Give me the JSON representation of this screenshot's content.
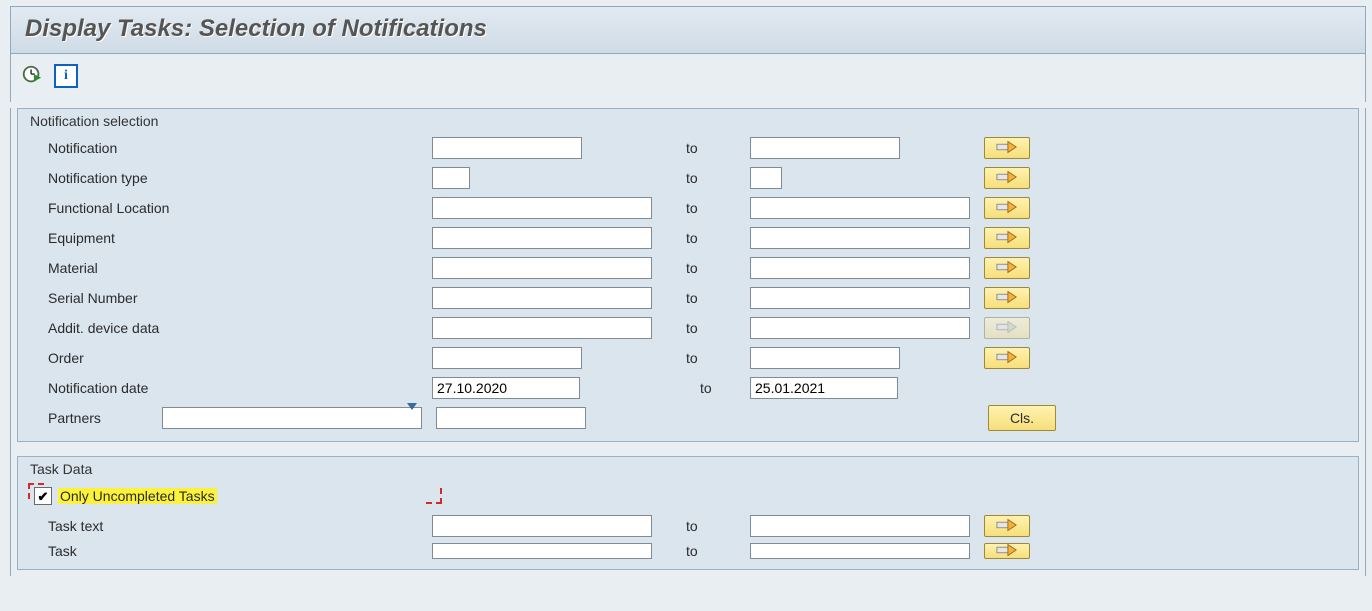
{
  "header": {
    "title": "Display Tasks: Selection of Notifications"
  },
  "toolbar": {
    "execute_icon": "execute-clock-icon",
    "info_icon": "i"
  },
  "groups": {
    "notif_sel": {
      "title": "Notification selection",
      "to_label": "to",
      "fields": {
        "notification": {
          "label": "Notification",
          "from": "",
          "to": ""
        },
        "notification_type": {
          "label": "Notification type",
          "from": "",
          "to": ""
        },
        "func_location": {
          "label": "Functional Location",
          "from": "",
          "to": ""
        },
        "equipment": {
          "label": "Equipment",
          "from": "",
          "to": ""
        },
        "material": {
          "label": "Material",
          "from": "",
          "to": ""
        },
        "serial_number": {
          "label": "Serial Number",
          "from": "",
          "to": ""
        },
        "addit_device": {
          "label": "Addit. device data",
          "from": "",
          "to": ""
        },
        "order": {
          "label": "Order",
          "from": "",
          "to": ""
        },
        "notif_date": {
          "label": "Notification date",
          "from": "27.10.2020",
          "to": "25.01.2021"
        },
        "partners": {
          "label": "Partners",
          "combo": "",
          "value": ""
        }
      },
      "cls_button": "Cls."
    },
    "task_data": {
      "title": "Task Data",
      "only_uncompleted": {
        "label": "Only Uncompleted Tasks",
        "checked": true
      },
      "to_label": "to",
      "fields": {
        "task_text": {
          "label": "Task text",
          "from": "",
          "to": ""
        },
        "task": {
          "label": "Task",
          "from": "",
          "to": ""
        }
      }
    }
  }
}
